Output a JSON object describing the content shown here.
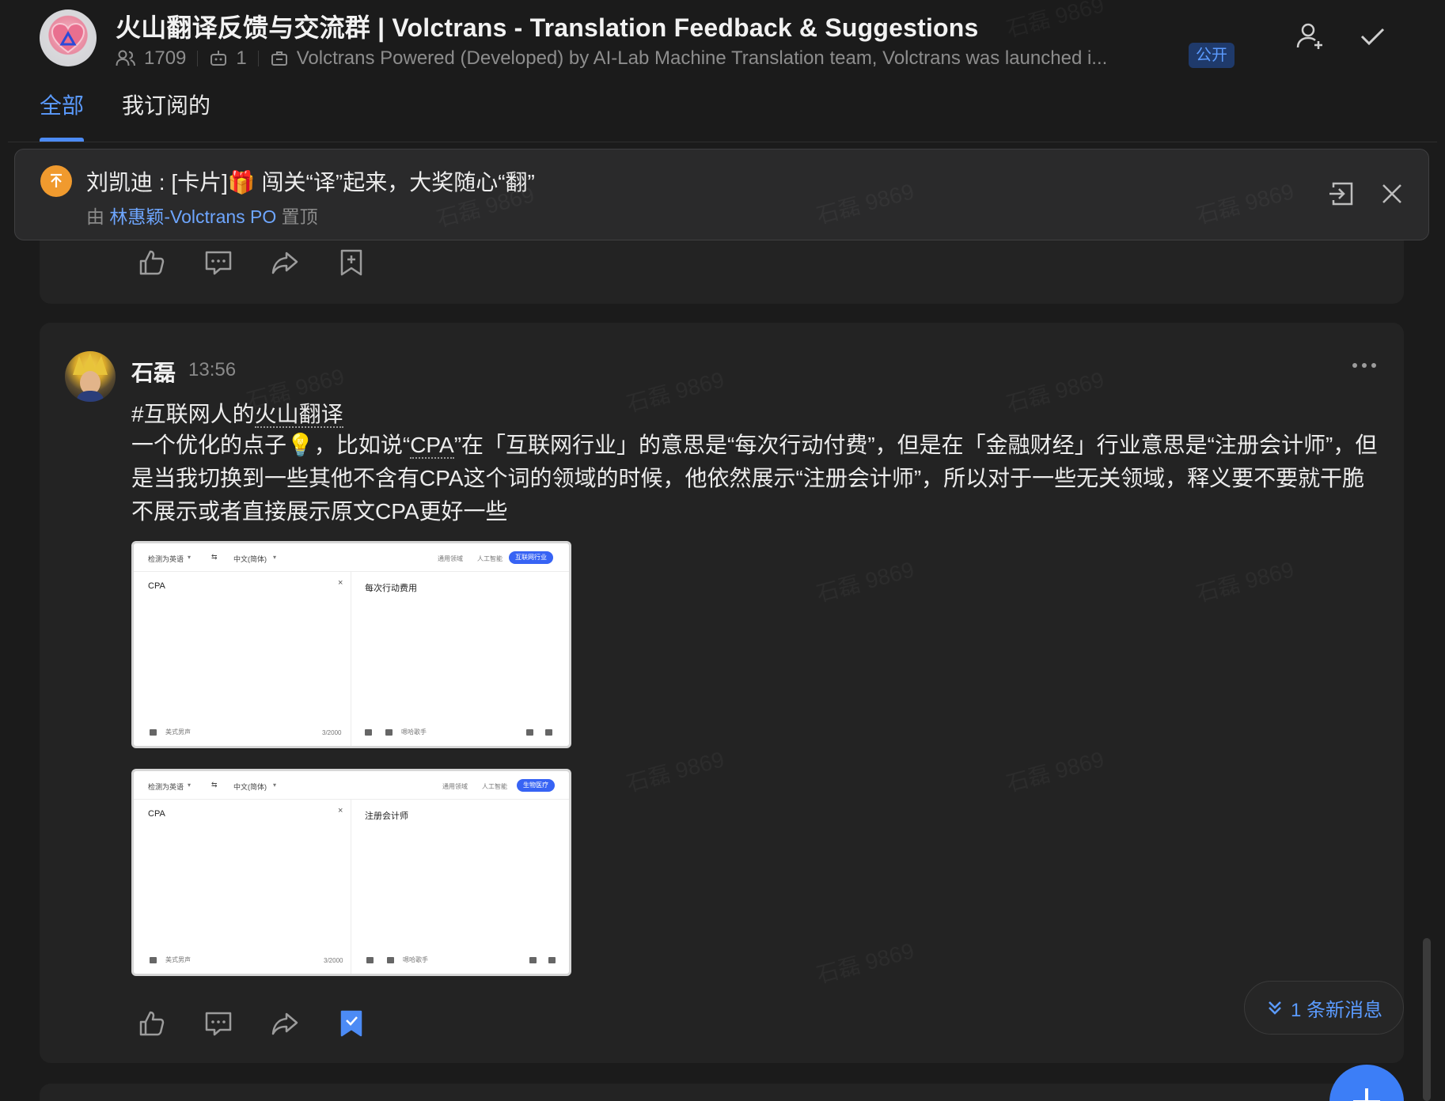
{
  "header": {
    "group_title": "火山翻译反馈与交流群 | Volctrans - Translation Feedback & Suggestions",
    "member_count": "1709",
    "bot_count": "1",
    "group_description": "Volctrans Powered (Developed) by AI-Lab Machine Translation team, Volctrans was launched i...",
    "public_badge": "公开",
    "icons": {
      "members": "people-icon",
      "bots": "robot-icon",
      "description": "briefcase-icon",
      "add_member": "add-person-icon",
      "done": "checkmark-icon"
    }
  },
  "tabs": [
    {
      "label": "全部",
      "active": true
    },
    {
      "label": "我订阅的",
      "active": false
    }
  ],
  "pinned": {
    "title": "刘凯迪 : [卡片]🎁 闯关“译”起来，大奖随心“翻”",
    "by_prefix": "由",
    "by_user": "林惠颖-Volctrans PO",
    "by_suffix": "置顶"
  },
  "post": {
    "author": "石磊",
    "time": "13:56",
    "hashtag_prefix": "#互联网人的",
    "hashtag_term": "火山翻译",
    "body_part1": "一个优化的点子💡，比如说“",
    "body_term": "CPA",
    "body_part2": "”在「互联网行业」的意思是“每次行动付费”，但是在「金融财经」行业意思是“注册会计师”，但是当我切换到一些其他不含有CPA这个词的领域的时候，他依然展示“注册会计师”，所以对于一些无关领域，释义要不要就干脆不展示或者直接展示原文CPA更好一些"
  },
  "screenshots": [
    {
      "source_lang": "检测为英语",
      "swap": "⇆",
      "target_lang": "中文(简体)",
      "domain_general": "通用领域",
      "domain_ai": "人工智能",
      "domain_selected": "互联网行业",
      "source_text": "CPA",
      "target_text": "每次行动费用",
      "voice_left": "美式男声",
      "char_count": "3/2000",
      "voice_right": "嗯哈歌手"
    },
    {
      "source_lang": "检测为英语",
      "swap": "⇆",
      "target_lang": "中文(简体)",
      "domain_general": "通用领域",
      "domain_ai": "人工智能",
      "domain_selected": "生物医疗",
      "source_text": "CPA",
      "target_text": "注册会计师",
      "voice_left": "美式男声",
      "char_count": "3/2000",
      "voice_right": "嗯哈歌手"
    }
  ],
  "new_messages": "1 条新消息",
  "watermark_text": "石磊 9869",
  "colors": {
    "accent": "#4c8bf5",
    "background": "#1b1b1b",
    "card": "#232323",
    "pin_icon": "#f09a2e"
  }
}
